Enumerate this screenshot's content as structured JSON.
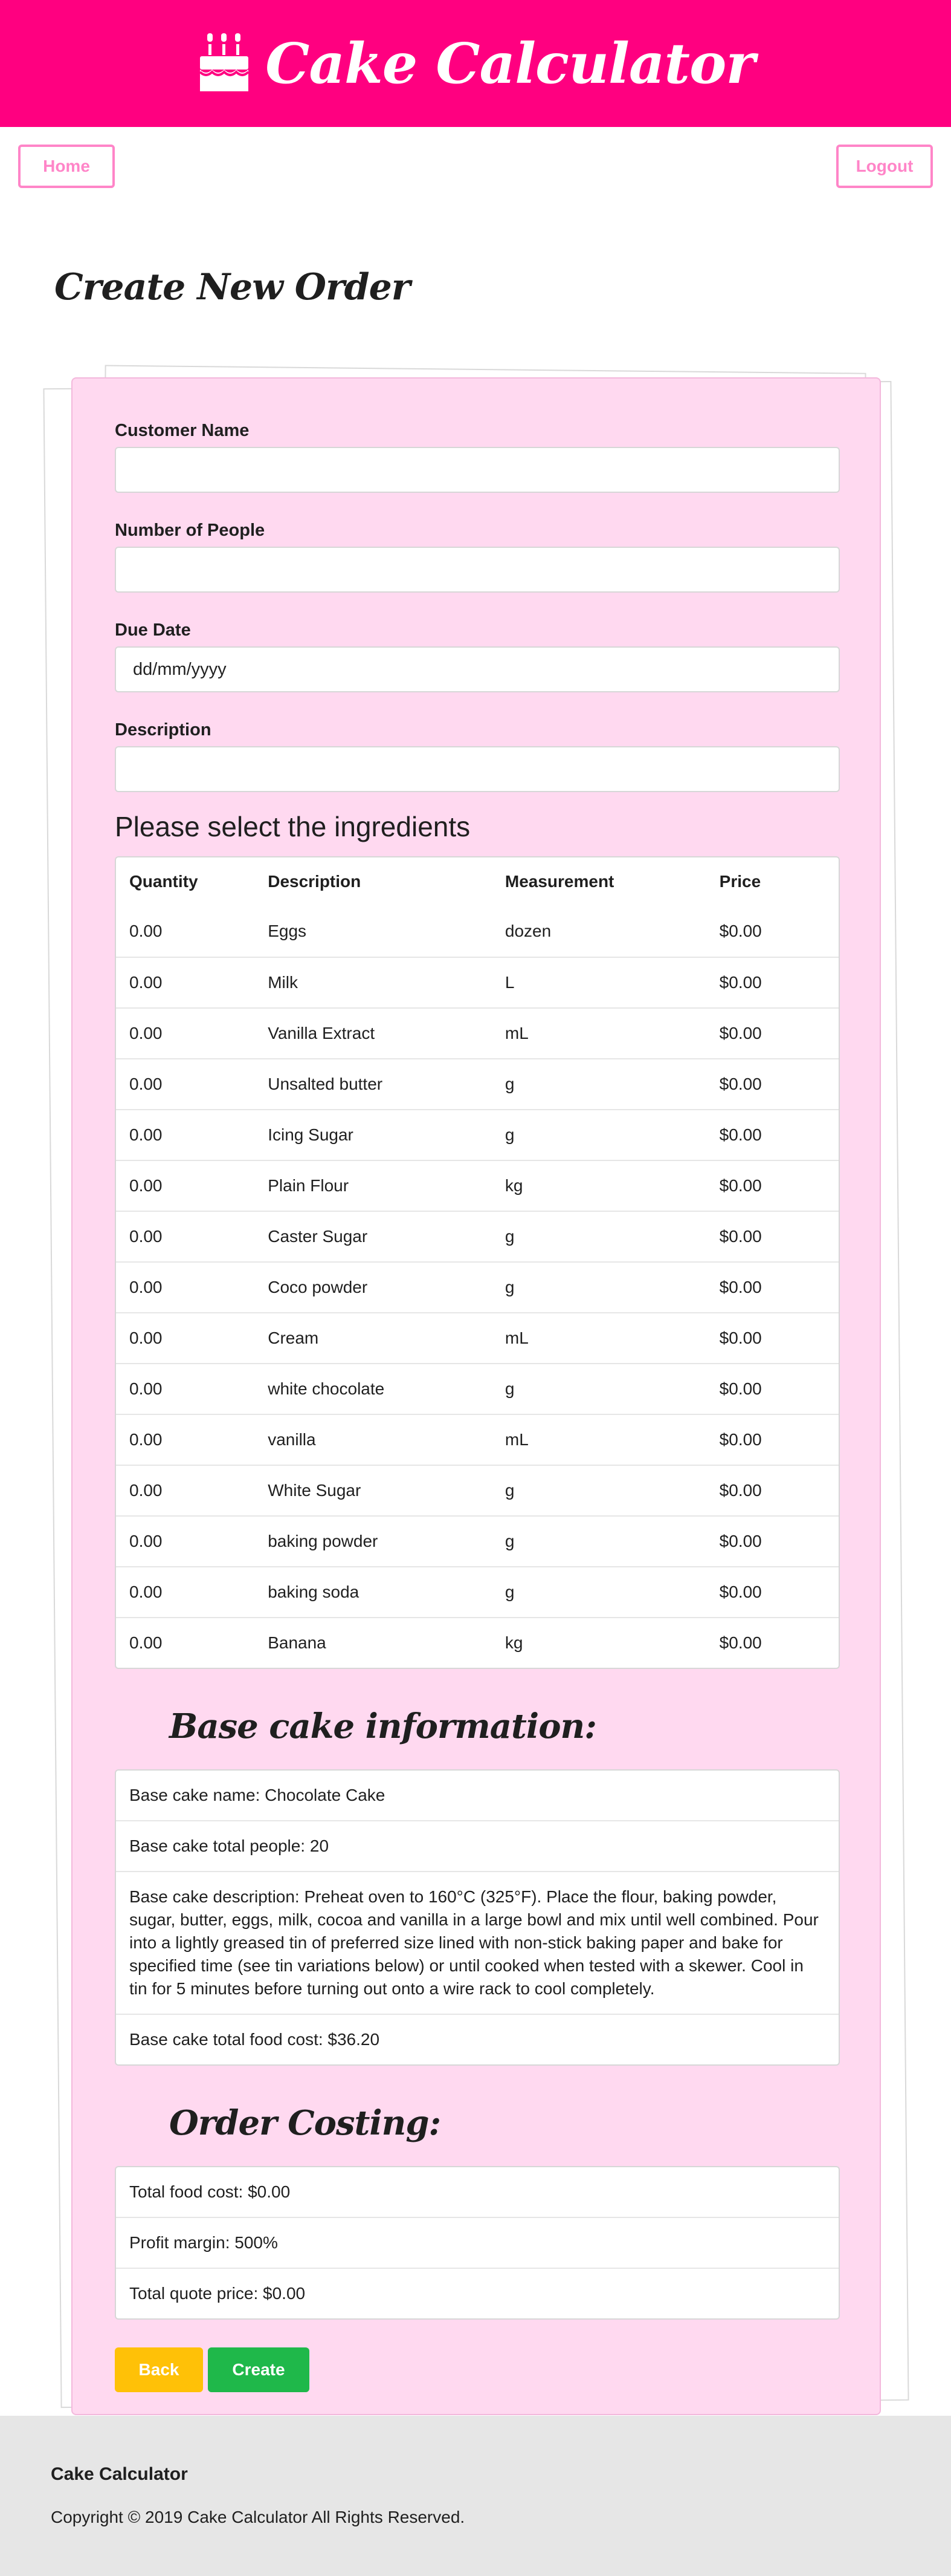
{
  "app": {
    "title": "Cake Calculator"
  },
  "colors": {
    "brand": "#ff0080",
    "nav_border": "#ff85c8",
    "card_bg": "#ffd9f0",
    "back": "#ffc107",
    "create": "#1fb84a"
  },
  "nav": {
    "home_label": "Home",
    "logout_label": "Logout"
  },
  "page": {
    "title": "Create New Order"
  },
  "form": {
    "customer_name_label": "Customer Name",
    "customer_name_value": "",
    "people_label": "Number of People",
    "people_value": "",
    "due_date_label": "Due Date",
    "due_date_placeholder": "dd/mm/yyyy",
    "description_label": "Description",
    "description_value": ""
  },
  "ingredients": {
    "heading": "Please select the ingredients",
    "columns": [
      "Quantity",
      "Description",
      "Measurement",
      "Price"
    ],
    "rows": [
      [
        "0.00",
        "Eggs",
        "dozen",
        "$0.00"
      ],
      [
        "0.00",
        "Milk",
        "L",
        "$0.00"
      ],
      [
        "0.00",
        "Vanilla Extract",
        "mL",
        "$0.00"
      ],
      [
        "0.00",
        "Unsalted butter",
        "g",
        "$0.00"
      ],
      [
        "0.00",
        "Icing Sugar",
        "g",
        "$0.00"
      ],
      [
        "0.00",
        "Plain Flour",
        "kg",
        "$0.00"
      ],
      [
        "0.00",
        "Caster Sugar",
        "g",
        "$0.00"
      ],
      [
        "0.00",
        "Coco powder",
        "g",
        "$0.00"
      ],
      [
        "0.00",
        "Cream",
        "mL",
        "$0.00"
      ],
      [
        "0.00",
        "white chocolate",
        "g",
        "$0.00"
      ],
      [
        "0.00",
        "vanilla",
        "mL",
        "$0.00"
      ],
      [
        "0.00",
        "White Sugar",
        "g",
        "$0.00"
      ],
      [
        "0.00",
        "baking powder",
        "g",
        "$0.00"
      ],
      [
        "0.00",
        "baking soda",
        "g",
        "$0.00"
      ],
      [
        "0.00",
        "Banana",
        "kg",
        "$0.00"
      ]
    ]
  },
  "base_cake": {
    "heading": "Base cake information:",
    "items": [
      "Base cake name: Chocolate Cake",
      "Base cake total people: 20",
      "Base cake description: Preheat oven to 160°C (325°F). Place the flour, baking powder, sugar, butter, eggs, milk, cocoa and vanilla in a large bowl and mix until well combined. Pour into a lightly greased tin of preferred size lined with non-stick baking paper and bake for specified time (see tin variations below) or until cooked when tested with a skewer. Cool in tin for 5 minutes before turning out onto a wire rack to cool completely.",
      "Base cake total food cost: $36.20"
    ]
  },
  "order_costing": {
    "heading": "Order Costing:",
    "items": [
      "Total food cost: $0.00",
      "Profit margin: 500%",
      "Total quote price: $0.00"
    ]
  },
  "actions": {
    "back_label": "Back",
    "create_label": "Create"
  },
  "footer": {
    "title": "Cake Calculator",
    "copyright": "Copyright © 2019 Cake Calculator All Rights Reserved."
  }
}
